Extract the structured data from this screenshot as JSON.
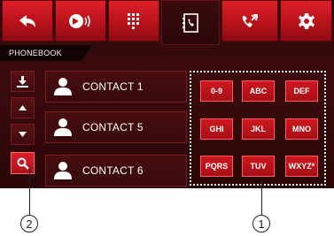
{
  "toolbar": {
    "icons": [
      "back-icon",
      "media-audio-icon",
      "dialpad-icon",
      "phonebook-icon",
      "call-log-icon",
      "settings-icon"
    ],
    "active": "phonebook-icon"
  },
  "section": {
    "title": "PHONEBOOK"
  },
  "sidebar": {
    "icons": [
      "download-icon",
      "scroll-up-icon",
      "scroll-down-icon",
      "search-icon"
    ]
  },
  "contacts": [
    {
      "name": "CONTACT 1"
    },
    {
      "name": "CONTACT 5"
    },
    {
      "name": "CONTACT 6"
    }
  ],
  "keypad": {
    "keys": [
      "0-9",
      "ABC",
      "DEF",
      "GHI",
      "JKL",
      "MNO",
      "PQRS",
      "TUV",
      "WXYZ*"
    ]
  },
  "callouts": {
    "keypad": "1",
    "search": "2"
  },
  "colors": {
    "accent": "#c8141c",
    "background": "#2f090a",
    "text": "#ffffff"
  }
}
